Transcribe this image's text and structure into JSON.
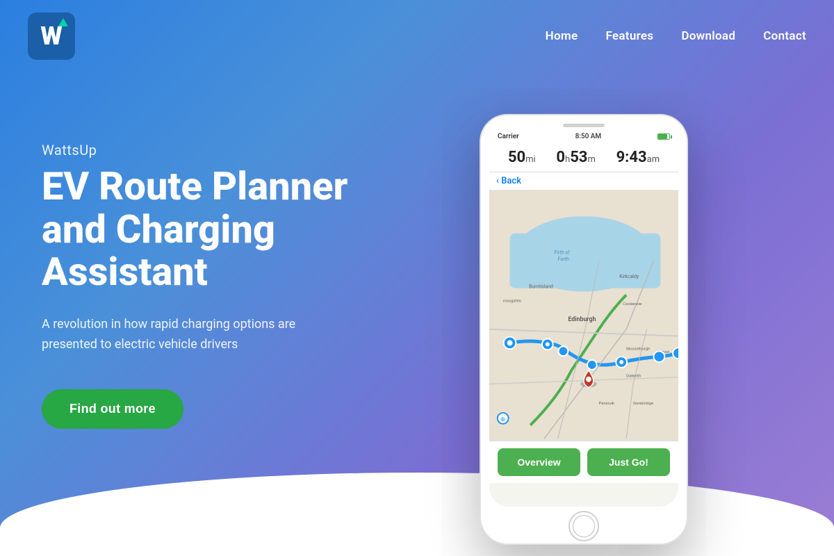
{
  "logo": {
    "letter": "W",
    "alt": "WattsUp Logo"
  },
  "nav": {
    "items": [
      {
        "label": "Home",
        "href": "#home"
      },
      {
        "label": "Features",
        "href": "#features"
      },
      {
        "label": "Download",
        "href": "#download"
      },
      {
        "label": "Contact",
        "href": "#contact"
      }
    ]
  },
  "hero": {
    "app_name": "WattsUp",
    "headline": "EV Route Planner and Charging Assistant",
    "description": "A revolution in how rapid charging options are presented to electric vehicle drivers",
    "cta_label": "Find out more"
  },
  "phone": {
    "status_bar": {
      "carrier": "Carrier",
      "time": "8:50 AM"
    },
    "trip": {
      "distance_value": "50",
      "distance_unit": "mi",
      "duration_value": "0",
      "duration_h": "h",
      "duration_min_value": "53",
      "duration_min_unit": "m",
      "arrival_value": "9:43",
      "arrival_unit": "am"
    },
    "back_label": "Back",
    "btn_overview": "Overview",
    "btn_just_go": "Just Go!"
  }
}
